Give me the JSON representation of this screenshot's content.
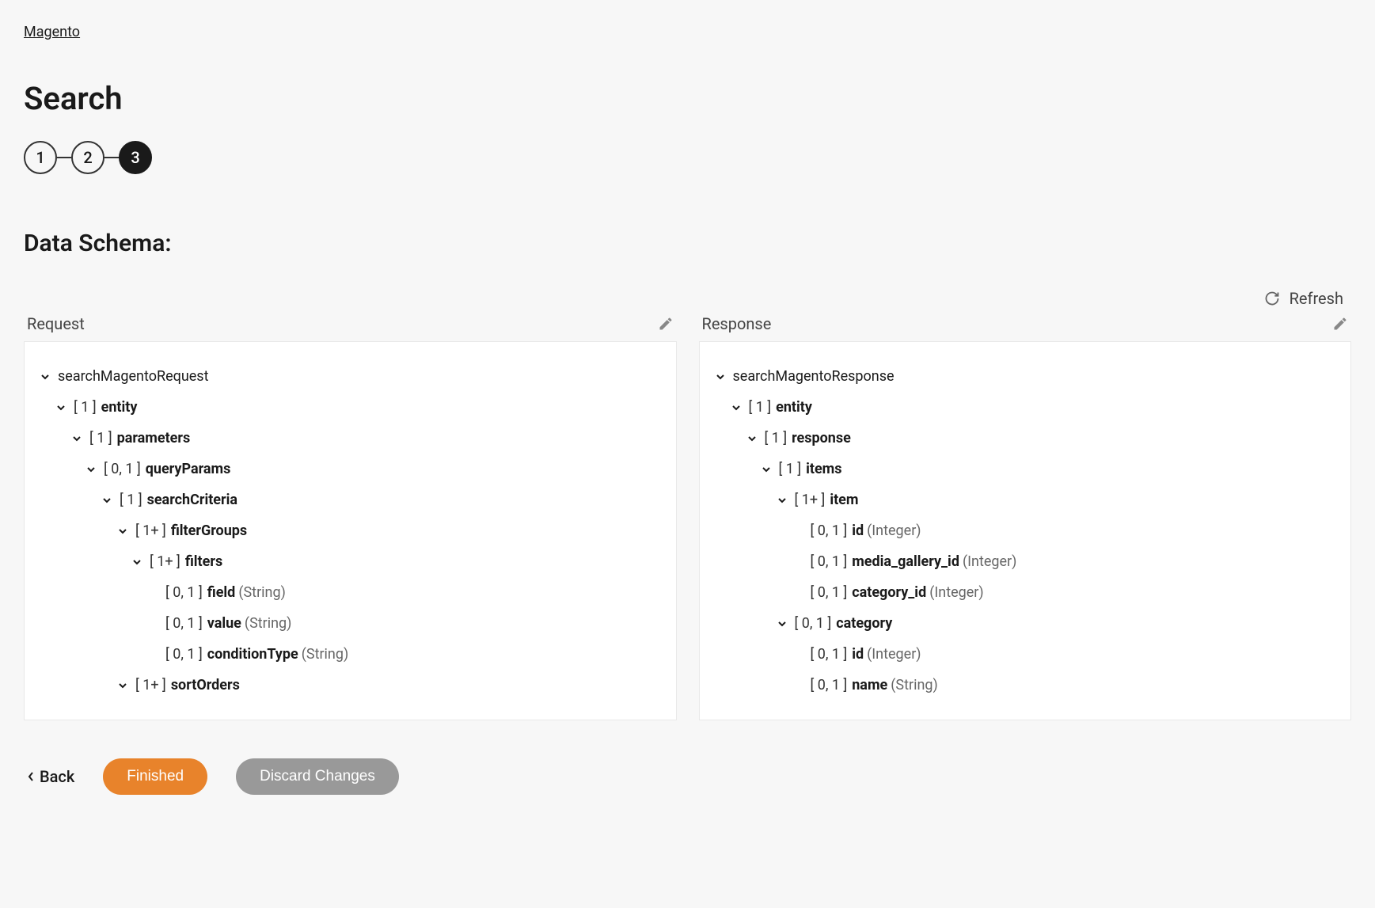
{
  "breadcrumb": "Magento",
  "page_title": "Search",
  "stepper": {
    "steps": [
      "1",
      "2",
      "3"
    ],
    "active_index": 2
  },
  "section_title": "Data Schema:",
  "refresh_label": "Refresh",
  "panels": {
    "request": {
      "label": "Request",
      "tree": [
        {
          "indent": 0,
          "expandable": true,
          "name": "searchMagentoRequest",
          "root": true
        },
        {
          "indent": 1,
          "expandable": true,
          "cardinality": "[ 1 ]",
          "name": "entity"
        },
        {
          "indent": 2,
          "expandable": true,
          "cardinality": "[ 1 ]",
          "name": "parameters"
        },
        {
          "indent": 3,
          "expandable": true,
          "cardinality": "[ 0, 1 ]",
          "name": "queryParams"
        },
        {
          "indent": 4,
          "expandable": true,
          "cardinality": "[ 1 ]",
          "name": "searchCriteria"
        },
        {
          "indent": 5,
          "expandable": true,
          "cardinality": "[ 1+ ]",
          "name": "filterGroups"
        },
        {
          "indent": 6,
          "expandable": true,
          "cardinality": "[ 1+ ]",
          "name": "filters"
        },
        {
          "indent": 7,
          "expandable": false,
          "cardinality": "[ 0, 1 ]",
          "name": "field",
          "type": "(String)"
        },
        {
          "indent": 7,
          "expandable": false,
          "cardinality": "[ 0, 1 ]",
          "name": "value",
          "type": "(String)"
        },
        {
          "indent": 7,
          "expandable": false,
          "cardinality": "[ 0, 1 ]",
          "name": "conditionType",
          "type": "(String)"
        },
        {
          "indent": 5,
          "expandable": true,
          "cardinality": "[ 1+ ]",
          "name": "sortOrders"
        }
      ]
    },
    "response": {
      "label": "Response",
      "tree": [
        {
          "indent": 0,
          "expandable": true,
          "name": "searchMagentoResponse",
          "root": true
        },
        {
          "indent": 1,
          "expandable": true,
          "cardinality": "[ 1 ]",
          "name": "entity"
        },
        {
          "indent": 2,
          "expandable": true,
          "cardinality": "[ 1 ]",
          "name": "response"
        },
        {
          "indent": 3,
          "expandable": true,
          "cardinality": "[ 1 ]",
          "name": "items"
        },
        {
          "indent": 4,
          "expandable": true,
          "cardinality": "[ 1+ ]",
          "name": "item"
        },
        {
          "indent": 5,
          "expandable": false,
          "cardinality": "[ 0, 1 ]",
          "name": "id",
          "type": "(Integer)"
        },
        {
          "indent": 5,
          "expandable": false,
          "cardinality": "[ 0, 1 ]",
          "name": "media_gallery_id",
          "type": "(Integer)"
        },
        {
          "indent": 5,
          "expandable": false,
          "cardinality": "[ 0, 1 ]",
          "name": "category_id",
          "type": "(Integer)"
        },
        {
          "indent": 4,
          "expandable": true,
          "cardinality": "[ 0, 1 ]",
          "name": "category"
        },
        {
          "indent": 5,
          "expandable": false,
          "cardinality": "[ 0, 1 ]",
          "name": "id",
          "type": "(Integer)"
        },
        {
          "indent": 5,
          "expandable": false,
          "cardinality": "[ 0, 1 ]",
          "name": "name",
          "type": "(String)"
        }
      ]
    }
  },
  "footer": {
    "back_label": "Back",
    "finished_label": "Finished",
    "discard_label": "Discard Changes"
  }
}
